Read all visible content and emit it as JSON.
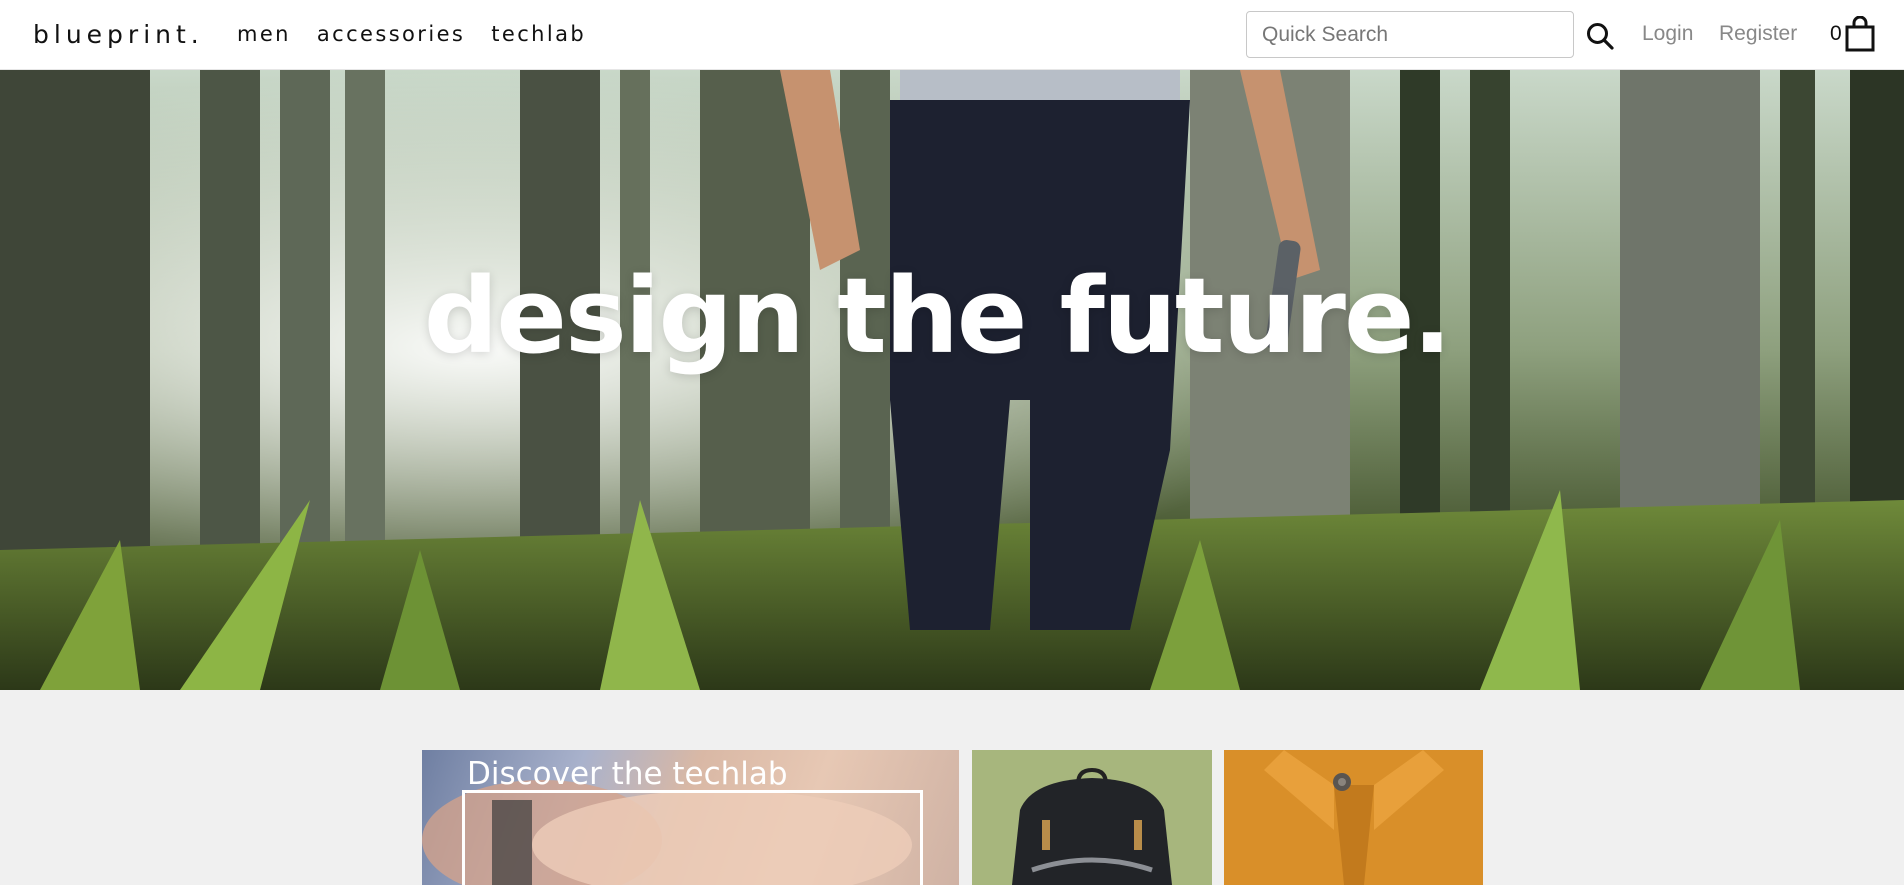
{
  "header": {
    "logo": "blueprint.",
    "nav": [
      "men",
      "accessories",
      "techlab"
    ],
    "search_placeholder": "Quick Search",
    "login_label": "Login",
    "register_label": "Register",
    "cart_count": "0"
  },
  "hero": {
    "headline": "design the future."
  },
  "cards": {
    "techlab_title": "Discover the techlab"
  },
  "colors": {
    "header_bg": "#ffffff",
    "page_bg": "#f0f0f0",
    "bag_card_bg": "#a7b67d",
    "shirt_card_bg": "#d98f29"
  },
  "icons": [
    "search-icon",
    "shopping-bag-icon"
  ]
}
